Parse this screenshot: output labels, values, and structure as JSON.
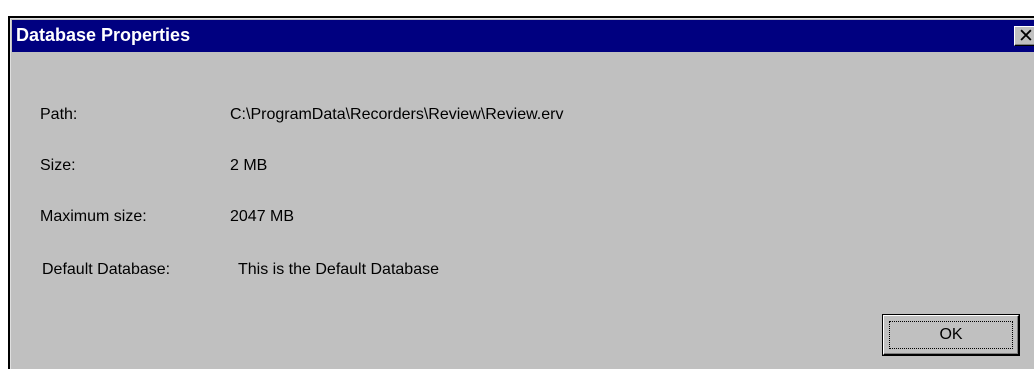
{
  "window": {
    "title": "Database Properties",
    "close_icon": "close-icon",
    "close_glyph": "✕"
  },
  "properties": {
    "path_label": "Path:",
    "path_value": "C:\\ProgramData\\Recorders\\Review\\Review.erv",
    "size_label": "Size:",
    "size_value": "2 MB",
    "max_size_label": "Maximum size:",
    "max_size_value": "2047 MB",
    "default_label": "Default Database:",
    "default_value": "This is the Default Database"
  },
  "buttons": {
    "ok_label": "OK"
  },
  "colors": {
    "titlebar": "#000080",
    "face": "#c0c0c0",
    "title_text": "#ffffff"
  }
}
